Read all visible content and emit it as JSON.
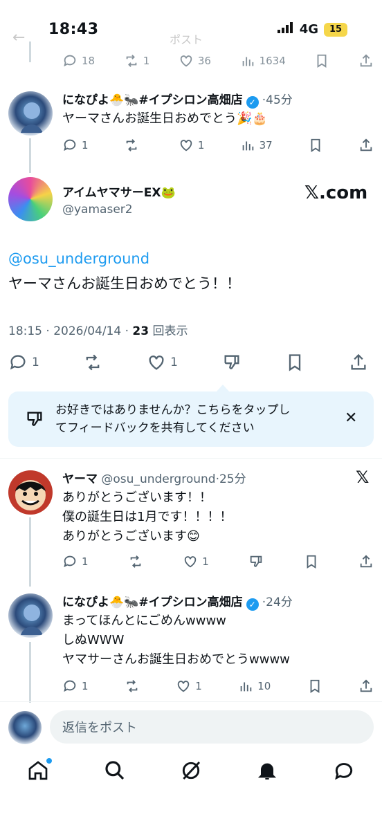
{
  "status": {
    "time": "18:43",
    "network": "4G",
    "battery": "15"
  },
  "ghost_header": {
    "title": "ポスト"
  },
  "top_counts": {
    "replies": "18",
    "reposts": "1",
    "likes": "36",
    "views": "1634"
  },
  "tweet1": {
    "display_name": "になぴよ🐣🐜#イプシロン高畑店",
    "time": "45分",
    "text": "ヤーマさんお誕生日おめでとう🎉🎂",
    "replies": "1",
    "reposts": "",
    "likes": "1",
    "views": "37"
  },
  "main": {
    "display_name": "アイムヤマサーEX🐸",
    "handle": "@yamaser2",
    "xcom": "𝕏.com",
    "mention": "@osu_underground",
    "text": "ヤーマさんお誕生日おめでとう！！",
    "meta_time": "18:15 · 2026/04/14 · ",
    "views_count": "23",
    "views_label": "回表示",
    "replies": "1",
    "likes": "1"
  },
  "feedback": {
    "line1": "お好きではありませんか？こちらをタップし",
    "line2": "てフィードバックを共有してください"
  },
  "reply1": {
    "display_name": "ヤーマ",
    "handle_time": "@osu_underground·25分",
    "lines": [
      "ありがとうございます！！",
      "僕の誕生日は1月です！！！！",
      "ありがとうございます😊"
    ],
    "replies": "1",
    "likes": "1"
  },
  "reply2": {
    "display_name": "になぴよ🐣🐜#イプシロン高畑店",
    "time": "24分",
    "lines": [
      "まってほんとにごめんwwww",
      "しぬWWW",
      "ヤマサーさんお誕生日おめでとうwwww"
    ],
    "replies": "1",
    "likes": "1",
    "views": "10"
  },
  "composer": {
    "placeholder": "返信をポスト"
  }
}
